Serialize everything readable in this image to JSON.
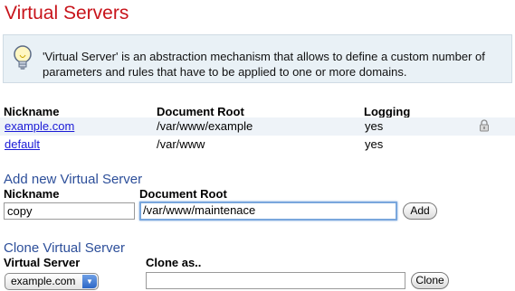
{
  "page_title": "Virtual Servers",
  "info": {
    "text": "'Virtual Server' is an abstraction mechanism that allows to define a custom number of parameters and rules that have to be applied to one or more domains."
  },
  "table": {
    "headers": [
      "Nickname",
      "Document Root",
      "Logging"
    ],
    "rows": [
      {
        "nickname": "example.com",
        "root": "/var/www/example",
        "logging": "yes",
        "locked": true
      },
      {
        "nickname": "default",
        "root": "/var/www",
        "logging": "yes",
        "locked": false
      }
    ]
  },
  "add": {
    "title": "Add new Virtual Server",
    "nickname_label": "Nickname",
    "root_label": "Document Root",
    "nickname_value": "copy",
    "root_value": "/var/www/maintenace",
    "button": "Add"
  },
  "clone": {
    "title": "Clone Virtual Server",
    "server_label": "Virtual Server",
    "clone_label": "Clone as..",
    "selected": "example.com",
    "clone_value": "",
    "button": "Clone"
  },
  "colors": {
    "title": "#c8141b",
    "section": "#2d4f9a",
    "link": "#1a1ad6",
    "info_bg": "#e9f1f6"
  }
}
